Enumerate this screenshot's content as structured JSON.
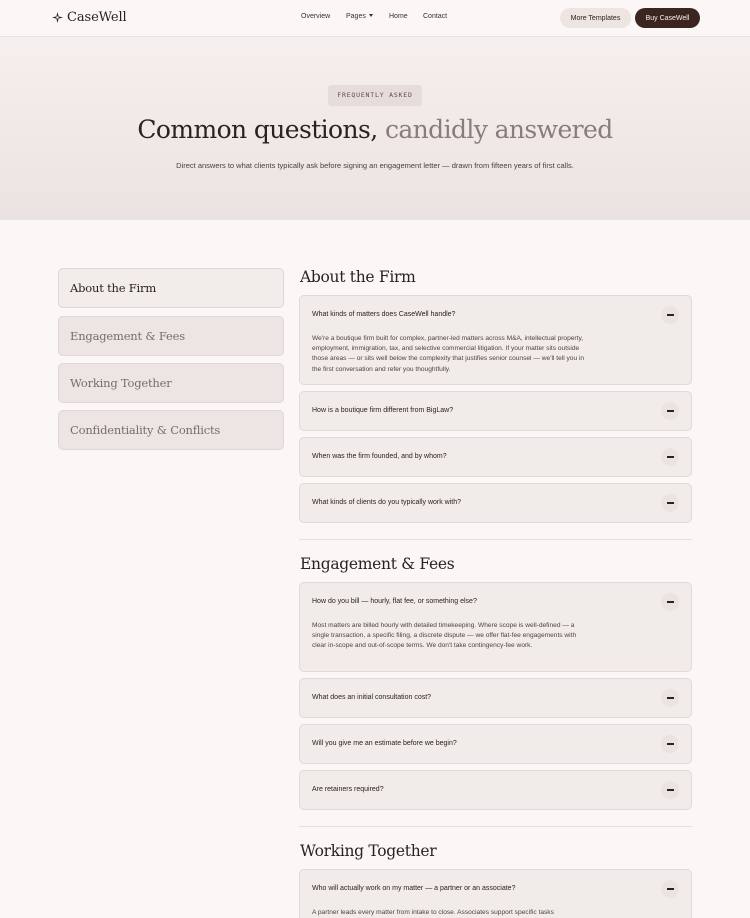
{
  "brand": {
    "name": "CaseWell",
    "icon": "compass-star-icon"
  },
  "nav": {
    "links": [
      "Overview",
      "Pages",
      "Home",
      "Contact"
    ],
    "more_templates": "More Templates",
    "buy": "Buy CaseWell"
  },
  "hero": {
    "eyebrow": "FREQUENTLY ASKED",
    "title_main": "Common questions,",
    "title_muted": "candidly answered",
    "subtitle": "Direct answers to what clients typically ask before signing an engagement letter — drawn from fifteen years of first calls."
  },
  "sidebar": {
    "items": [
      {
        "label": "About the Firm",
        "active": true
      },
      {
        "label": "Engagement & Fees",
        "active": false
      },
      {
        "label": "Working Together",
        "active": false
      },
      {
        "label": "Confidentiality & Conflicts",
        "active": false
      }
    ]
  },
  "sections": [
    {
      "title": "About the Firm",
      "faqs": [
        {
          "q": "What kinds of matters does CaseWell handle?",
          "a": "We're a boutique firm built for complex, partner-led matters across M&A, intellectual property, employment, immigration, tax, and selective commercial litigation. If your matter sits outside those areas — or sits well below the complexity that justifies senior counsel — we'll tell you in the first conversation and refer you thoughtfully."
        },
        {
          "q": "How is a boutique firm different from BigLaw?"
        },
        {
          "q": "When was the firm founded, and by whom?"
        },
        {
          "q": "What kinds of clients do you typically work with?"
        }
      ]
    },
    {
      "title": "Engagement & Fees",
      "faqs": [
        {
          "q": "How do you bill — hourly, flat fee, or something else?",
          "a": "Most matters are billed hourly with detailed timekeeping. Where scope is well-defined — a single transaction, a specific filing, a discrete dispute — we offer flat-fee engagements with clear in-scope and out-of-scope terms. We don't take contingency-fee work."
        },
        {
          "q": "What does an initial consultation cost?"
        },
        {
          "q": "Will you give me an estimate before we begin?"
        },
        {
          "q": "Are retainers required?"
        }
      ]
    },
    {
      "title": "Working Together",
      "faqs": [
        {
          "q": "Who will actually work on my matter — a partner or an associate?",
          "a": "A partner leads every matter from intake to close. Associates support specific tasks"
        }
      ]
    }
  ]
}
